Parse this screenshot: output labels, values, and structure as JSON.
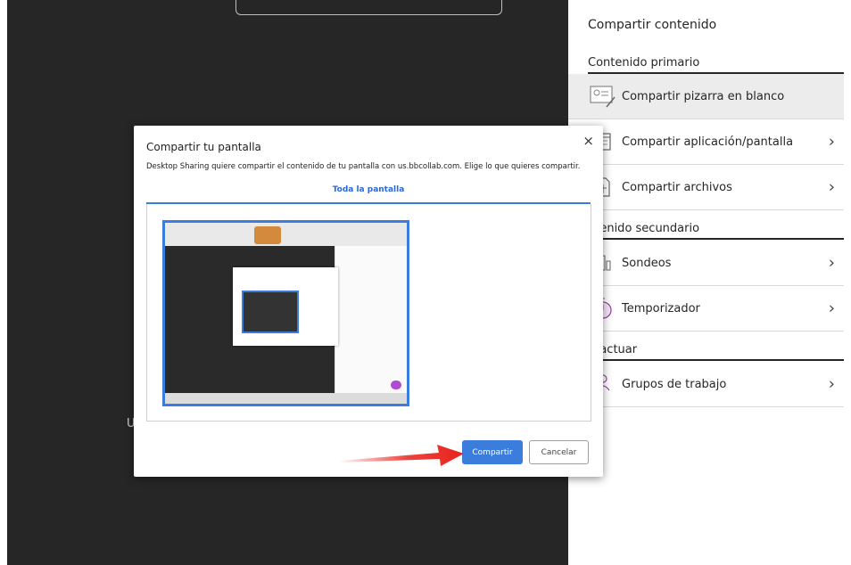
{
  "panel": {
    "title": "Compartir contenido",
    "sections": {
      "primary": "Contenido primario",
      "secondary": "ntenido secundario",
      "interact": "eractuar"
    },
    "items": [
      {
        "label": "Compartir pizarra en blanco",
        "icon": "whiteboard-icon"
      },
      {
        "label": "Compartir aplicación/pantalla",
        "icon": "window-icon"
      },
      {
        "label": "Compartir archivos",
        "icon": "files-icon"
      },
      {
        "label": "Sondeos",
        "icon": "polls-icon"
      },
      {
        "label": "Temporizador",
        "icon": "timer-icon"
      },
      {
        "label": "Grupos de trabajo",
        "icon": "groups-icon"
      }
    ]
  },
  "stage": {
    "partial_text": "U"
  },
  "dialog": {
    "title": "Compartir tu pantalla",
    "close": "×",
    "description": "Desktop Sharing quiere compartir el contenido de tu pantalla con us.bbcollab.com. Elige lo que quieres compartir.",
    "tab": "Toda la pantalla",
    "share_label": "Compartir",
    "cancel_label": "Cancelar"
  },
  "colors": {
    "accent": "#3b7ddd",
    "arrow": "#e8221b",
    "stage": "#262626"
  }
}
